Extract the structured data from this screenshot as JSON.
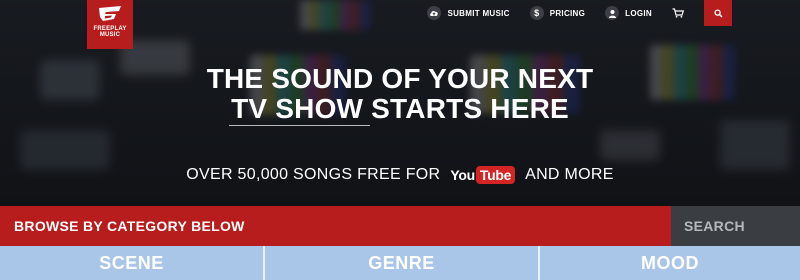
{
  "brand": {
    "logo_line1": "FREEPLAY",
    "logo_line2": "MUSIC"
  },
  "nav": {
    "submit_label": "SUBMIT MUSIC",
    "pricing_label": "PRICING",
    "login_label": "LOGIN",
    "icons": {
      "submit": "cloud-upload-icon",
      "pricing": "dollar-icon",
      "login": "user-icon",
      "cart": "cart-icon",
      "search": "search-icon"
    }
  },
  "hero": {
    "headline_line1": "THE SOUND OF YOUR NEXT",
    "headline_line2": "TV SHOW STARTS HERE",
    "tagline_before": "OVER 50,000 SONGS FREE FOR",
    "youtube_you": "You",
    "youtube_tube": "Tube",
    "tagline_after": "AND MORE"
  },
  "browse": {
    "label": "BROWSE BY CATEGORY BELOW",
    "search_placeholder": "SEARCH"
  },
  "categories": [
    "SCENE",
    "GENRE",
    "MOOD"
  ],
  "colors": {
    "brand_red": "#b81d1d",
    "category_blue": "#a9c6e9",
    "search_gray": "#3a3d42"
  }
}
